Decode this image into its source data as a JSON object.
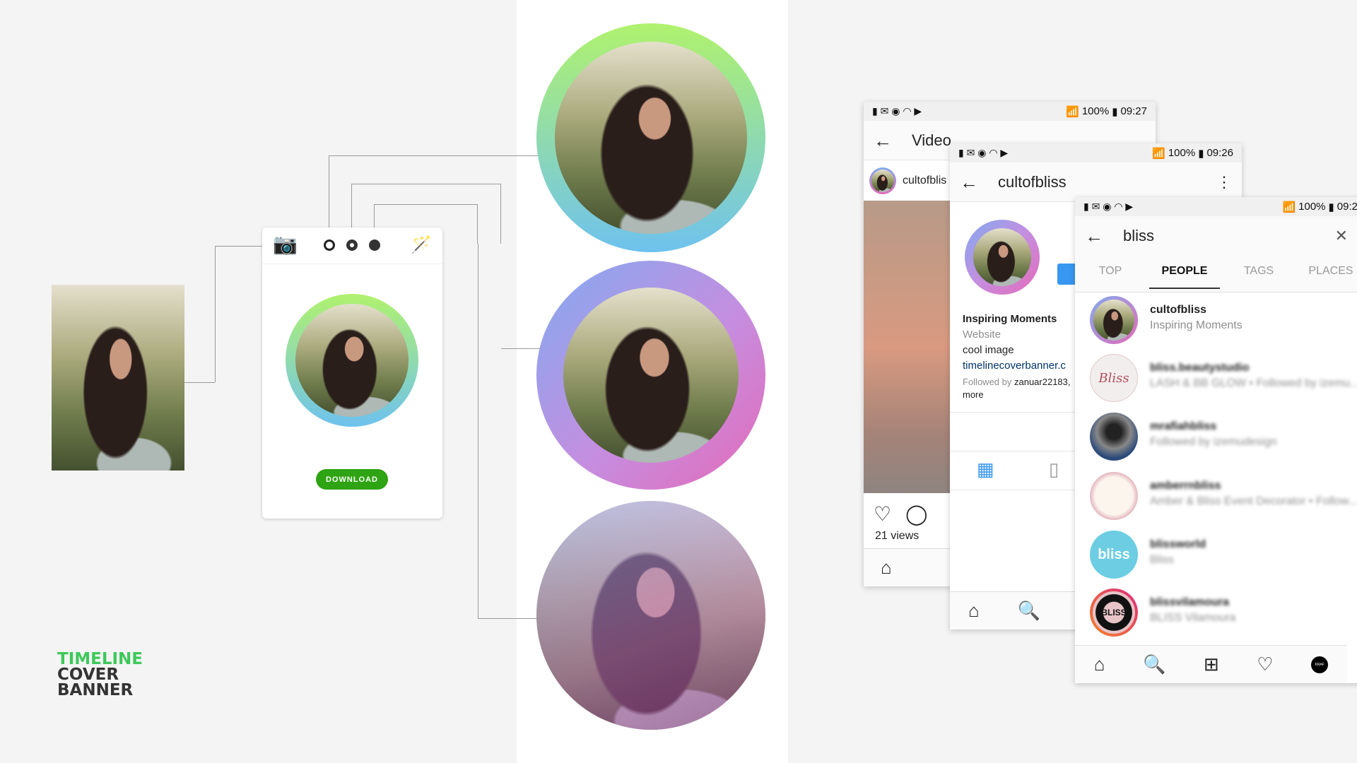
{
  "brand": {
    "line1": "TIMELINE",
    "line2": "COVER",
    "line3": "BANNER",
    "accent": "#3ec95a"
  },
  "editor": {
    "add_photo_icon": "camera-plus-icon",
    "frame_options": [
      "ring-thin",
      "ring-thick",
      "filled"
    ],
    "effects_icon": "magic-wand-icon",
    "download_label": "DOWNLOAD",
    "download_color": "#2ea313"
  },
  "phone_video": {
    "status": {
      "battery": "100%",
      "time": "09:27"
    },
    "title": "Video",
    "username": "cultofblis",
    "views": "21 views"
  },
  "phone_profile": {
    "status": {
      "battery": "100%",
      "time": "09:26"
    },
    "title": "cultofbliss",
    "name": "Inspiring Moments",
    "category": "Website",
    "bio": "cool image",
    "link": "timelinecoverbanner.c",
    "followed_prefix": "Followed by ",
    "followed_user": "zanuar22183,",
    "followed_more": "more"
  },
  "phone_search": {
    "status": {
      "battery": "100%",
      "time": "09:2"
    },
    "query": "bliss",
    "tabs": [
      "TOP",
      "PEOPLE",
      "TAGS",
      "PLACES"
    ],
    "active_tab": "PEOPLE",
    "results": [
      {
        "name": "cultofbliss",
        "sub": "Inspiring Moments"
      },
      {
        "name": "bliss.beautystudio",
        "sub": "LASH & BB GLOW • Followed by izemu..."
      },
      {
        "name": "mrafiahbliss",
        "sub": "Followed by izemudesign"
      },
      {
        "name": "amberrnbliss",
        "sub": "Amber & Bliss Event Decorator • Follow..."
      },
      {
        "name": "blissworld",
        "sub": "Bliss"
      },
      {
        "name": "blissvilamoura",
        "sub": "BLISS Vilamoura"
      }
    ],
    "avatar_texts": {
      "bliss": "bliss",
      "bliss_vilamoura": "BLISS",
      "kraf": "KRAF"
    }
  }
}
